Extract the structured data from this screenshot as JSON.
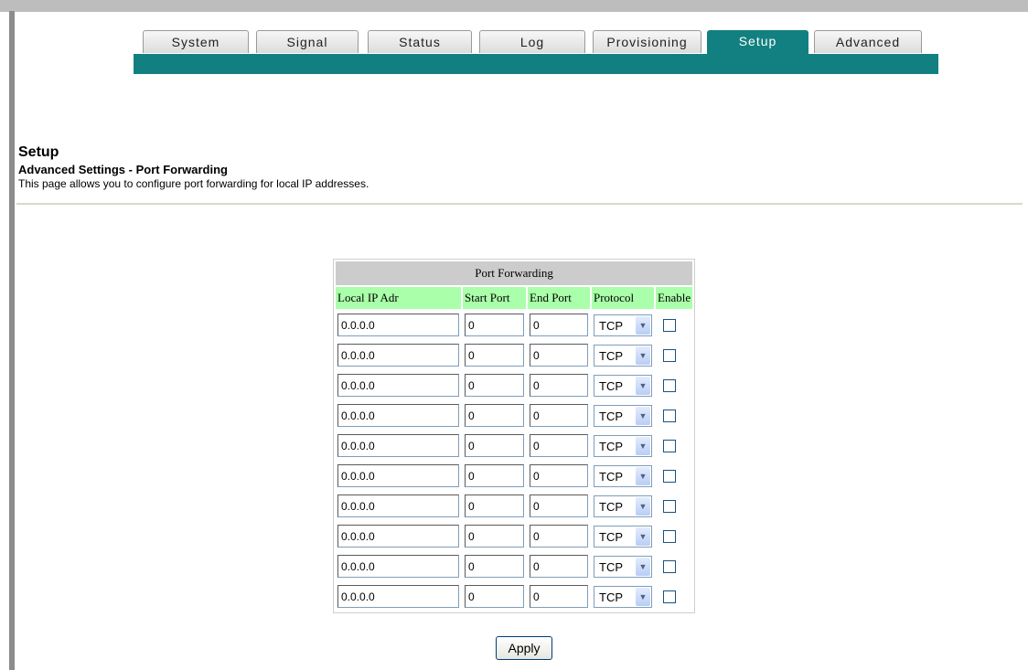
{
  "nav": {
    "tabs": [
      {
        "label": "System"
      },
      {
        "label": "Signal"
      },
      {
        "label": "Status"
      },
      {
        "label": "Log"
      },
      {
        "label": "Provisioning"
      },
      {
        "label": "Setup",
        "active": true
      },
      {
        "label": "Advanced"
      }
    ]
  },
  "page": {
    "heading": "Setup",
    "subheading": "Advanced Settings - Port Forwarding",
    "description": "This page allows you to configure port forwarding for local IP addresses."
  },
  "table": {
    "title": "Port Forwarding",
    "columns": [
      "Local IP Adr",
      "Start Port",
      "End Port",
      "Protocol",
      "Enable"
    ],
    "rows": [
      {
        "ip": "0.0.0.0",
        "start": "0",
        "end": "0",
        "protocol": "TCP",
        "enabled": false
      },
      {
        "ip": "0.0.0.0",
        "start": "0",
        "end": "0",
        "protocol": "TCP",
        "enabled": false
      },
      {
        "ip": "0.0.0.0",
        "start": "0",
        "end": "0",
        "protocol": "TCP",
        "enabled": false
      },
      {
        "ip": "0.0.0.0",
        "start": "0",
        "end": "0",
        "protocol": "TCP",
        "enabled": false
      },
      {
        "ip": "0.0.0.0",
        "start": "0",
        "end": "0",
        "protocol": "TCP",
        "enabled": false
      },
      {
        "ip": "0.0.0.0",
        "start": "0",
        "end": "0",
        "protocol": "TCP",
        "enabled": false
      },
      {
        "ip": "0.0.0.0",
        "start": "0",
        "end": "0",
        "protocol": "TCP",
        "enabled": false
      },
      {
        "ip": "0.0.0.0",
        "start": "0",
        "end": "0",
        "protocol": "TCP",
        "enabled": false
      },
      {
        "ip": "0.0.0.0",
        "start": "0",
        "end": "0",
        "protocol": "TCP",
        "enabled": false
      },
      {
        "ip": "0.0.0.0",
        "start": "0",
        "end": "0",
        "protocol": "TCP",
        "enabled": false
      }
    ]
  },
  "actions": {
    "apply_label": "Apply"
  },
  "icons": {
    "dropdown_arrow": "chevron-down-icon"
  },
  "colors": {
    "accent": "#128080",
    "header_row": "#aaffaa",
    "title_row": "#cccccc"
  }
}
